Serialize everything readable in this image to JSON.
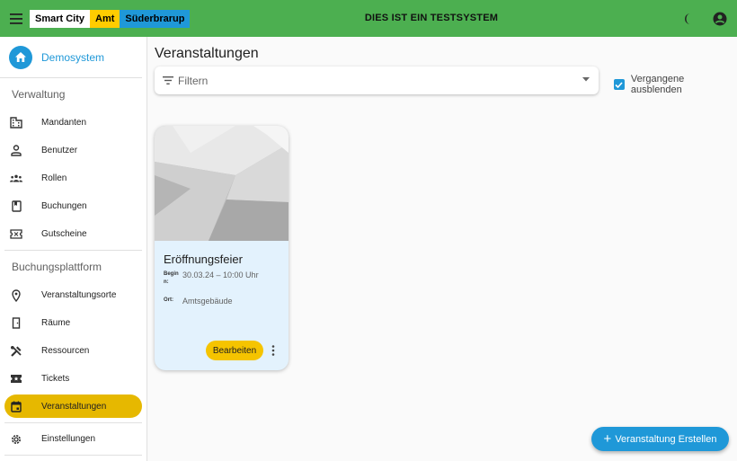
{
  "header": {
    "brand": [
      "Smart City",
      "Amt",
      "Süderbrarup"
    ],
    "center_title": "DIES IST EIN TESTSYSTEM",
    "icons": [
      "menu-icon",
      "dark-mode-icon",
      "account-circle-icon"
    ]
  },
  "sidebar": {
    "tenant": "Demosystem",
    "sections": [
      {
        "title": "Verwaltung",
        "items": [
          {
            "label": "Mandanten",
            "icon": "domain-icon"
          },
          {
            "label": "Benutzer",
            "icon": "person-icon"
          },
          {
            "label": "Rollen",
            "icon": "groups-icon"
          },
          {
            "label": "Buchungen",
            "icon": "book-icon"
          },
          {
            "label": "Gutscheine",
            "icon": "voucher-icon"
          }
        ]
      },
      {
        "title": "Buchungsplattform",
        "items": [
          {
            "label": "Veranstaltungsorte",
            "icon": "location-icon"
          },
          {
            "label": "Räume",
            "icon": "door-icon"
          },
          {
            "label": "Ressourcen",
            "icon": "tools-icon"
          },
          {
            "label": "Tickets",
            "icon": "ticket-icon"
          },
          {
            "label": "Veranstaltungen",
            "icon": "calendar-icon",
            "active": true
          }
        ]
      }
    ],
    "settings": {
      "label": "Einstellungen",
      "icon": "gear-icon"
    }
  },
  "main": {
    "title": "Veranstaltungen",
    "filter_placeholder": "Filtern",
    "hide_past": {
      "label": "Vergangene ausblenden",
      "checked": true
    },
    "events": [
      {
        "title": "Eröffnungsfeier",
        "begin_label": "Begin n:",
        "begin_value": "30.03.24 – 10:00 Uhr",
        "place_label": "Ort:",
        "place_value": "Amtsgebäude",
        "edit_label": "Bearbeiten"
      }
    ],
    "fab_label": "Veranstaltung Erstellen"
  },
  "colors": {
    "header": "#4caf50",
    "accent": "#1f98d8",
    "active": "#e6b800",
    "card": "#e3f2fd"
  }
}
